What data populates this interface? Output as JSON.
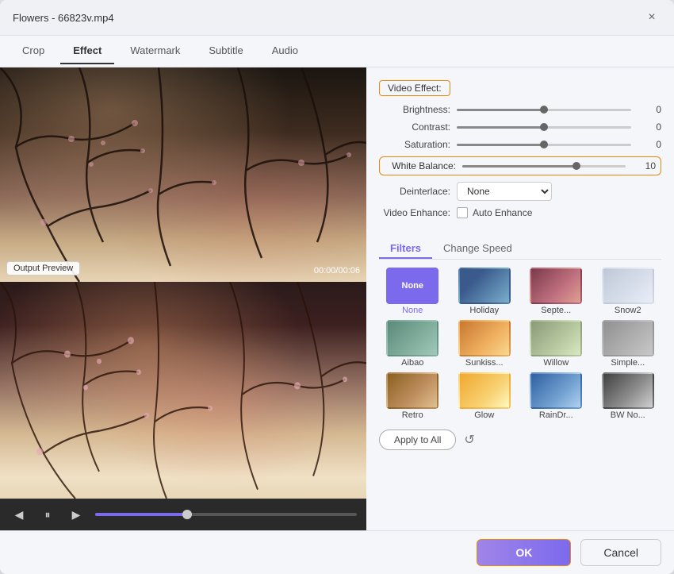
{
  "window": {
    "title": "Flowers - 66823v.mp4",
    "close_label": "×"
  },
  "tabs": [
    {
      "label": "Crop",
      "active": false
    },
    {
      "label": "Effect",
      "active": true
    },
    {
      "label": "Watermark",
      "active": false
    },
    {
      "label": "Subtitle",
      "active": false
    },
    {
      "label": "Audio",
      "active": false
    }
  ],
  "video_effect": {
    "section_label": "Video Effect:",
    "brightness": {
      "label": "Brightness:",
      "value": 0,
      "pct": 50
    },
    "contrast": {
      "label": "Contrast:",
      "value": 0,
      "pct": 50
    },
    "saturation": {
      "label": "Saturation:",
      "value": 0,
      "pct": 50
    },
    "white_balance": {
      "label": "White Balance:",
      "value": 10,
      "pct": 70
    },
    "deinterlace": {
      "label": "Deinterlace:",
      "option": "None"
    },
    "video_enhance_label": "Video Enhance:",
    "auto_enhance_label": "Auto Enhance"
  },
  "filters": {
    "tab_filters": "Filters",
    "tab_change_speed": "Change Speed",
    "items": [
      {
        "name": "None",
        "selected_thumb": true,
        "selected_label": true,
        "class": "ft-none-sel"
      },
      {
        "name": "Holiday",
        "selected_thumb": false,
        "selected_label": false,
        "class": "ft-holiday"
      },
      {
        "name": "Septe...",
        "selected_thumb": false,
        "selected_label": false,
        "class": "ft-septe"
      },
      {
        "name": "Snow2",
        "selected_thumb": false,
        "selected_label": false,
        "class": "ft-snow2"
      },
      {
        "name": "Aibao",
        "selected_thumb": false,
        "selected_label": false,
        "class": "ft-aibao"
      },
      {
        "name": "Sunkiss...",
        "selected_thumb": false,
        "selected_label": false,
        "class": "ft-sunkiss"
      },
      {
        "name": "Willow",
        "selected_thumb": false,
        "selected_label": false,
        "class": "ft-willow"
      },
      {
        "name": "Simple...",
        "selected_thumb": false,
        "selected_label": false,
        "class": "ft-simple"
      },
      {
        "name": "Retro",
        "selected_thumb": false,
        "selected_label": false,
        "class": "ft-retro"
      },
      {
        "name": "Glow",
        "selected_thumb": false,
        "selected_label": false,
        "class": "ft-glow"
      },
      {
        "name": "RainDr...",
        "selected_thumb": false,
        "selected_label": false,
        "class": "ft-raindr"
      },
      {
        "name": "BW No...",
        "selected_thumb": false,
        "selected_label": false,
        "class": "ft-bwno"
      }
    ]
  },
  "apply": {
    "apply_to_all_label": "Apply to All",
    "refresh_label": "↺"
  },
  "preview": {
    "output_label": "Output Preview",
    "time": "00:00/00:06"
  },
  "controls": {
    "prev_label": "◀",
    "play_label": "⏸",
    "next_label": "▶"
  },
  "buttons": {
    "ok_label": "OK",
    "cancel_label": "Cancel"
  }
}
